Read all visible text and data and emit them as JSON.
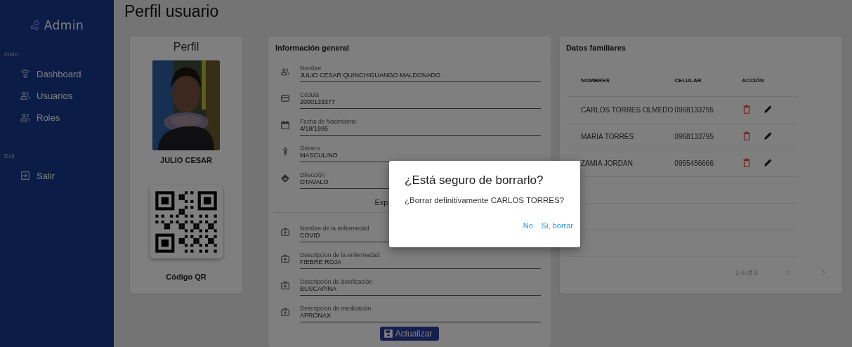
{
  "sidebar": {
    "logo": "Admin",
    "sections": [
      {
        "heading": "main",
        "items": [
          {
            "label": "Dashboard",
            "kind": "wifi"
          },
          {
            "label": "Usuarios",
            "kind": "people"
          },
          {
            "label": "Roles",
            "kind": "people"
          }
        ]
      },
      {
        "heading": "Exit",
        "items": [
          {
            "label": "Salir",
            "kind": "exit"
          }
        ]
      }
    ]
  },
  "page_title": "Perfil usuario",
  "profile": {
    "title": "Perfil",
    "name": "JULIO CESAR",
    "qr_caption": "Código QR"
  },
  "info": {
    "title": "Información general",
    "fields": [
      {
        "label": "Nombre",
        "value": "JULIO CESAR QUINCHIGUANGO MALDONADO",
        "kind": "people"
      },
      {
        "label": "Cédula",
        "value": "2000133377",
        "kind": "card"
      },
      {
        "label": "Fecha de Nacimiento",
        "value": "4/18/1995",
        "kind": "calendar"
      },
      {
        "label": "Género",
        "value": "MASCULINO",
        "kind": "person"
      },
      {
        "label": "Dirección",
        "value": "OTAVALO",
        "kind": "direction"
      }
    ],
    "expander": "Exp",
    "medical_fields": [
      {
        "label": "Nombre de la enfermedad",
        "value": "COVID",
        "kind": "medical"
      },
      {
        "label": "Descripcion de la enfermedad",
        "value": "FIEBRE ROJA",
        "kind": "medical"
      },
      {
        "label": "Descripción de dosificación",
        "value": "BUSCAPINA",
        "kind": "medical"
      },
      {
        "label": "Descripcion de medicación",
        "value": "APRONAX",
        "kind": "medical"
      }
    ],
    "button": "Actualizar"
  },
  "family": {
    "title": "Datos familiares",
    "columns": [
      "NOMBRES",
      "CELULAR",
      "ACCIÓN"
    ],
    "rows": [
      {
        "name": "CARLOS TORRES OLMEDO",
        "phone": "0968133795"
      },
      {
        "name": "MARIA TORRES",
        "phone": "0968133795"
      },
      {
        "name": "ZAMIA JORDAN",
        "phone": "0955456666"
      }
    ],
    "pagination": "1-6 of 3"
  },
  "dialog": {
    "title": "¿Está seguro de borrarlo?",
    "message": "¿Borrar definitivamente CARLOS TORRES?",
    "buttons": [
      "No",
      "Si, borrar"
    ]
  }
}
